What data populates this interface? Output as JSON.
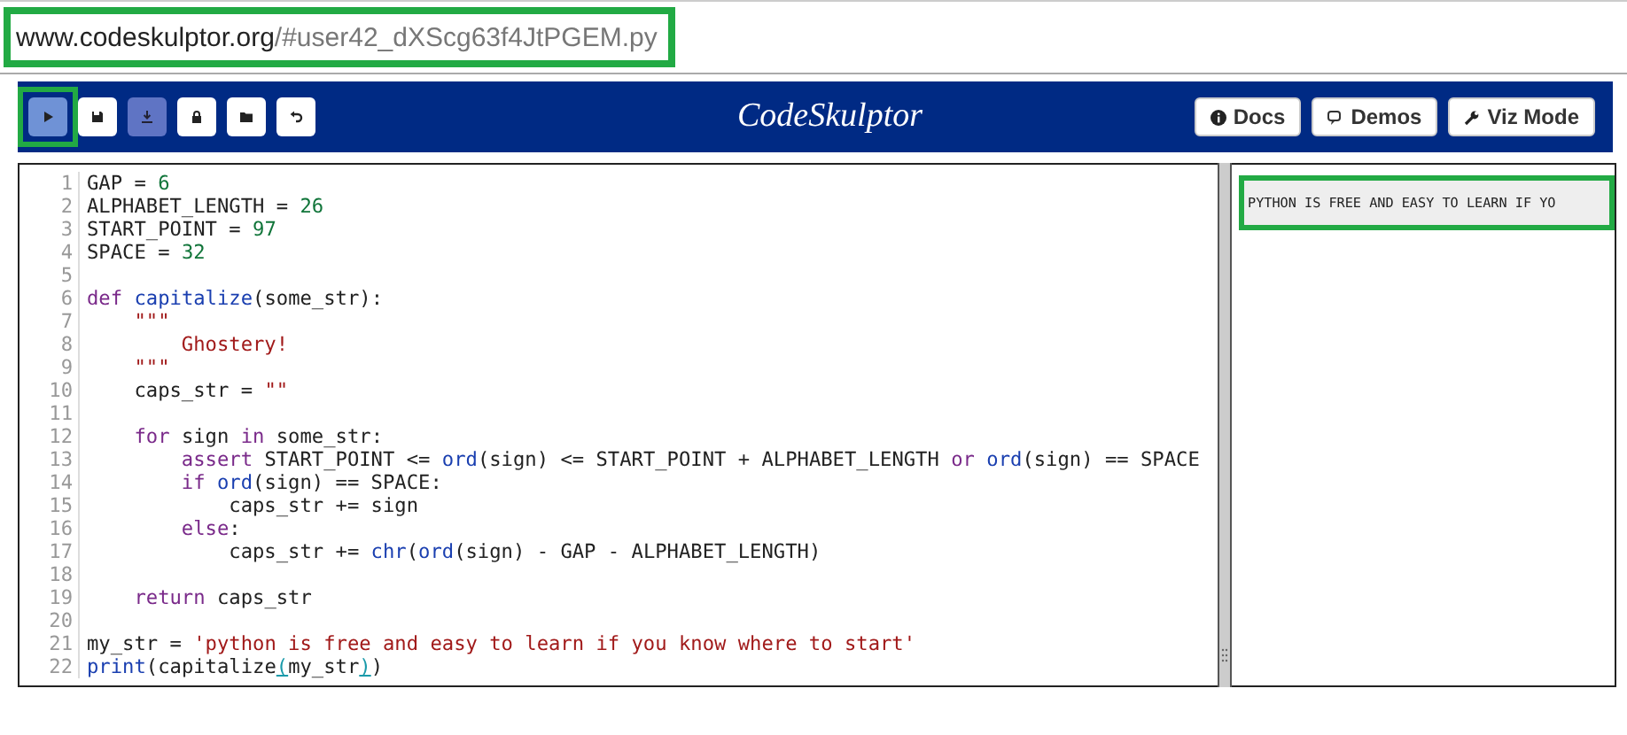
{
  "address_bar": {
    "host": "www.codeskulptor.org",
    "path": "/#user42_dXScg63f4JtPGEM.py",
    "highlighted": true
  },
  "toolbar": {
    "tool_buttons": [
      {
        "kind": "run",
        "pressed": true,
        "disabled": false,
        "highlighted": true
      },
      {
        "kind": "save",
        "pressed": false,
        "disabled": false,
        "highlighted": false
      },
      {
        "kind": "download",
        "pressed": false,
        "disabled": true,
        "highlighted": false
      },
      {
        "kind": "lock",
        "pressed": false,
        "disabled": false,
        "highlighted": false
      },
      {
        "kind": "open",
        "pressed": false,
        "disabled": false,
        "highlighted": false
      },
      {
        "kind": "reset",
        "pressed": false,
        "disabled": false,
        "highlighted": false
      }
    ],
    "logo": "CodeSkulptor",
    "link_buttons": [
      {
        "kind": "info",
        "label": "Docs"
      },
      {
        "kind": "demos",
        "label": "Demos"
      },
      {
        "kind": "wrench",
        "label": "Viz Mode"
      }
    ]
  },
  "editor": {
    "lines": [
      {
        "number": "1",
        "tokens": [
          {
            "kind": "plain",
            "text": "GAP = "
          },
          {
            "kind": "number",
            "text": "6"
          }
        ]
      },
      {
        "number": "2",
        "tokens": [
          {
            "kind": "plain",
            "text": "ALPHABET_LENGTH = "
          },
          {
            "kind": "number",
            "text": "26"
          }
        ]
      },
      {
        "number": "3",
        "tokens": [
          {
            "kind": "plain",
            "text": "START_POINT = "
          },
          {
            "kind": "number",
            "text": "97"
          }
        ]
      },
      {
        "number": "4",
        "tokens": [
          {
            "kind": "plain",
            "text": "SPACE = "
          },
          {
            "kind": "number",
            "text": "32"
          }
        ]
      },
      {
        "number": "5"
      },
      {
        "number": "6",
        "tokens": [
          {
            "kind": "keyword",
            "text": "def"
          },
          {
            "kind": "def",
            "text": " capitalize"
          },
          {
            "kind": "plain",
            "text": "(some_str):"
          }
        ]
      },
      {
        "number": "7",
        "tokens": [
          {
            "kind": "string",
            "text": "    \"\"\""
          }
        ]
      },
      {
        "number": "8",
        "tokens": [
          {
            "kind": "string",
            "text": "        Ghostery!"
          }
        ]
      },
      {
        "number": "9",
        "tokens": [
          {
            "kind": "string",
            "text": "    \"\"\""
          }
        ]
      },
      {
        "number": "10",
        "tokens": [
          {
            "kind": "plain",
            "text": "    caps_str = "
          },
          {
            "kind": "string",
            "text": "\"\""
          }
        ]
      },
      {
        "number": "11"
      },
      {
        "number": "12",
        "tokens": [
          {
            "kind": "keyword",
            "text": "    for"
          },
          {
            "kind": "plain",
            "text": " sign "
          },
          {
            "kind": "keyword",
            "text": "in"
          },
          {
            "kind": "plain",
            "text": " some_str:"
          }
        ]
      },
      {
        "number": "13",
        "tokens": [
          {
            "kind": "keyword",
            "text": "        assert"
          },
          {
            "kind": "plain",
            "text": " START_POINT <= "
          },
          {
            "kind": "builtin",
            "text": "ord"
          },
          {
            "kind": "plain",
            "text": "(sign) <= START_POINT + ALPHABET_LENGTH "
          },
          {
            "kind": "keyword",
            "text": "or"
          },
          {
            "kind": "builtin",
            "text": " ord"
          },
          {
            "kind": "plain",
            "text": "(sign) == SPACE"
          }
        ]
      },
      {
        "number": "14",
        "tokens": [
          {
            "kind": "keyword",
            "text": "        if"
          },
          {
            "kind": "builtin",
            "text": " ord"
          },
          {
            "kind": "plain",
            "text": "(sign) == SPACE:"
          }
        ]
      },
      {
        "number": "15",
        "tokens": [
          {
            "kind": "plain",
            "text": "            caps_str += sign"
          }
        ]
      },
      {
        "number": "16",
        "tokens": [
          {
            "kind": "keyword",
            "text": "        else"
          },
          {
            "kind": "plain",
            "text": ":"
          }
        ]
      },
      {
        "number": "17",
        "tokens": [
          {
            "kind": "plain",
            "text": "            caps_str += "
          },
          {
            "kind": "builtin",
            "text": "chr"
          },
          {
            "kind": "plain",
            "text": "("
          },
          {
            "kind": "builtin",
            "text": "ord"
          },
          {
            "kind": "plain",
            "text": "(sign) - GAP - ALPHABET_LENGTH)"
          }
        ]
      },
      {
        "number": "18"
      },
      {
        "number": "19",
        "tokens": [
          {
            "kind": "keyword",
            "text": "    return"
          },
          {
            "kind": "plain",
            "text": " caps_str"
          }
        ]
      },
      {
        "number": "20"
      },
      {
        "number": "21",
        "tokens": [
          {
            "kind": "plain",
            "text": "my_str = "
          },
          {
            "kind": "string",
            "text": "'python is free and easy to learn if you know where to start'"
          }
        ]
      },
      {
        "number": "22",
        "tokens": [
          {
            "kind": "builtin",
            "text": "print"
          },
          {
            "kind": "plain",
            "text": "(capitalize"
          },
          {
            "kind": "bracket",
            "text": "("
          },
          {
            "kind": "plain",
            "text": "my_str"
          },
          {
            "kind": "bracket",
            "text": ")"
          },
          {
            "kind": "plain",
            "text": ")"
          }
        ]
      }
    ]
  },
  "output": {
    "lines": [
      {
        "text": "PYTHON IS FREE AND EASY TO LEARN IF YO",
        "highlighted": true
      }
    ]
  }
}
